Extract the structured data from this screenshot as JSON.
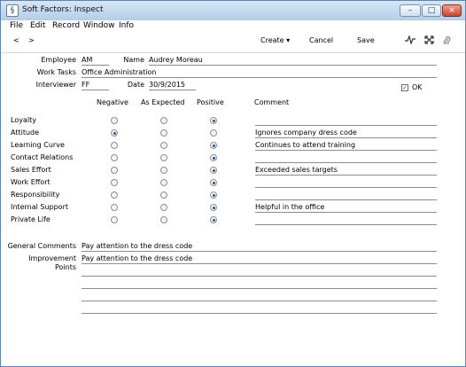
{
  "window": {
    "title": "Soft Factors: Inspect",
    "app_icon": "§",
    "controls": {
      "minimize": "–",
      "maximize": "□",
      "close": "×"
    }
  },
  "menubar": [
    "File",
    "Edit",
    "Record",
    "Window",
    "Info"
  ],
  "toolbar": {
    "prev": "<",
    "next": ">",
    "create": "Create ▾",
    "cancel": "Cancel",
    "save": "Save"
  },
  "header": {
    "employee_label": "Employee",
    "employee_value": "AM",
    "name_label": "Name",
    "name_value": "Audrey Moreau",
    "work_tasks_label": "Work Tasks",
    "work_tasks_value": "Office Administration",
    "interviewer_label": "Interviewer",
    "interviewer_value": "FF",
    "date_label": "Date",
    "date_value": "30/9/2015",
    "ok_label": "OK",
    "ok_checked": true
  },
  "grid": {
    "columns": [
      "Negative",
      "As Expected",
      "Positive",
      "Comment"
    ],
    "rows": [
      {
        "label": "Loyalty",
        "rating": "Positive",
        "comment": ""
      },
      {
        "label": "Attitude",
        "rating": "Negative",
        "comment": "Ignores company dress code"
      },
      {
        "label": "Learning Curve",
        "rating": "Positive",
        "comment": "Continues to attend training"
      },
      {
        "label": "Contact Relations",
        "rating": "Positive",
        "comment": ""
      },
      {
        "label": "Sales Effort",
        "rating": "Positive",
        "comment": "Exceeded sales targets"
      },
      {
        "label": "Work Effort",
        "rating": "Positive",
        "comment": ""
      },
      {
        "label": "Responsibility",
        "rating": "Positive",
        "comment": ""
      },
      {
        "label": "Internal Support",
        "rating": "Positive",
        "comment": "Helpful in the office"
      },
      {
        "label": "Private Life",
        "rating": "Positive",
        "comment": ""
      }
    ]
  },
  "footer": {
    "general_comments_label": "General Comments",
    "general_comments_value": "Pay attention to the dress code",
    "improvement_points_label": "Improvement Points",
    "improvement_points_value": "Pay attention to the dress code"
  }
}
